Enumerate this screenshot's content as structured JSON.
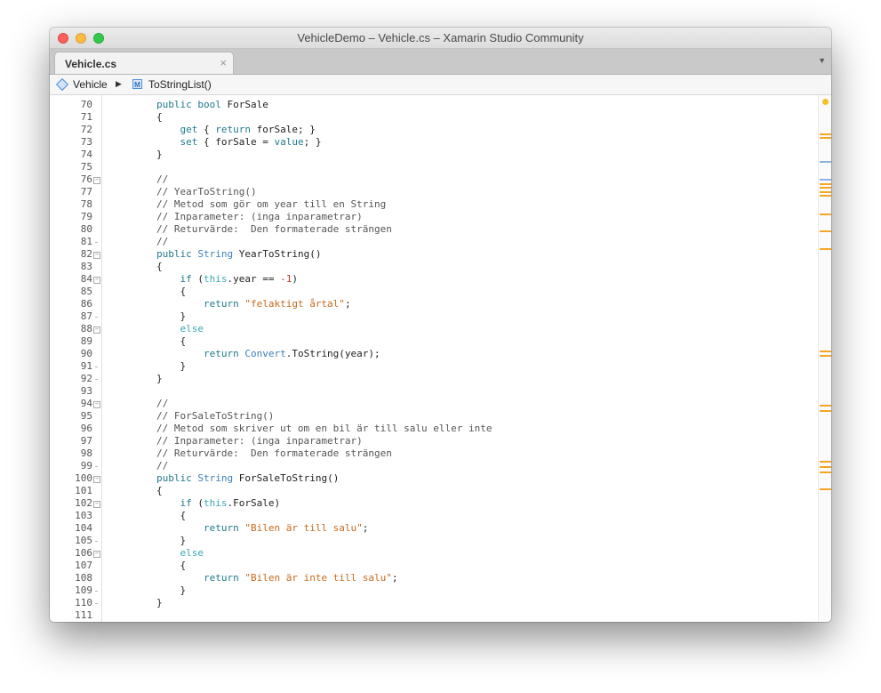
{
  "window": {
    "title": "VehicleDemo – Vehicle.cs – Xamarin Studio Community"
  },
  "tabs": [
    {
      "label": "Vehicle.cs",
      "close": "×"
    }
  ],
  "tab_menu_icon": "▼",
  "breadcrumb": {
    "class_icon": "class-icon",
    "class_name": "Vehicle",
    "separator": "▶",
    "method_icon_letter": "M",
    "method_name": "ToStringList()"
  },
  "colors": {
    "keyword": "#1f7a8c",
    "type": "#3e7fb8",
    "string": "#c66b1e",
    "comment": "#555555",
    "overview_orange": "#f5a623",
    "overview_blue": "#8fb3e0"
  },
  "code_lines": [
    {
      "n": "70",
      "fold": "",
      "tokens": [
        [
          "",
          "        "
        ],
        [
          "kw",
          "public"
        ],
        [
          "",
          " "
        ],
        [
          "kw",
          "bool"
        ],
        [
          "",
          " ForSale"
        ]
      ]
    },
    {
      "n": "71",
      "fold": "",
      "tokens": [
        [
          "",
          "        {"
        ]
      ]
    },
    {
      "n": "72",
      "fold": "",
      "tokens": [
        [
          "",
          "            "
        ],
        [
          "kw",
          "get"
        ],
        [
          "",
          " { "
        ],
        [
          "kw",
          "return"
        ],
        [
          "",
          " forSale; }"
        ]
      ]
    },
    {
      "n": "73",
      "fold": "",
      "tokens": [
        [
          "",
          "            "
        ],
        [
          "kw",
          "set"
        ],
        [
          "",
          " { forSale = "
        ],
        [
          "kw",
          "value"
        ],
        [
          "",
          "; }"
        ]
      ]
    },
    {
      "n": "74",
      "fold": "",
      "tokens": [
        [
          "",
          "        }"
        ]
      ]
    },
    {
      "n": "75",
      "fold": "",
      "tokens": [
        [
          "",
          ""
        ]
      ]
    },
    {
      "n": "76",
      "fold": "minus",
      "tokens": [
        [
          "cm",
          "        //"
        ]
      ]
    },
    {
      "n": "77",
      "fold": "",
      "tokens": [
        [
          "cm",
          "        // YearToString()"
        ]
      ]
    },
    {
      "n": "78",
      "fold": "",
      "tokens": [
        [
          "cm",
          "        // Metod som gör om year till en String"
        ]
      ]
    },
    {
      "n": "79",
      "fold": "",
      "tokens": [
        [
          "cm",
          "        // Inparameter: (inga inparametrar)"
        ]
      ]
    },
    {
      "n": "80",
      "fold": "",
      "tokens": [
        [
          "cm",
          "        // Returvärde:  Den formaterade strängen"
        ]
      ]
    },
    {
      "n": "81",
      "fold": "tick",
      "tokens": [
        [
          "cm",
          "        //"
        ]
      ]
    },
    {
      "n": "82",
      "fold": "minus",
      "tokens": [
        [
          "",
          "        "
        ],
        [
          "kw",
          "public"
        ],
        [
          "",
          " "
        ],
        [
          "ty",
          "String"
        ],
        [
          "",
          " YearToString()"
        ]
      ]
    },
    {
      "n": "83",
      "fold": "",
      "tokens": [
        [
          "",
          "        {"
        ]
      ]
    },
    {
      "n": "84",
      "fold": "minus",
      "tokens": [
        [
          "",
          "            "
        ],
        [
          "kw",
          "if"
        ],
        [
          "",
          " ("
        ],
        [
          "kw2",
          "this"
        ],
        [
          "",
          ".year == "
        ],
        [
          "nm",
          "-1"
        ],
        [
          "",
          ")"
        ]
      ]
    },
    {
      "n": "85",
      "fold": "",
      "tokens": [
        [
          "",
          "            {"
        ]
      ]
    },
    {
      "n": "86",
      "fold": "",
      "tokens": [
        [
          "",
          "                "
        ],
        [
          "kw",
          "return"
        ],
        [
          "",
          " "
        ],
        [
          "st",
          "\"felaktigt årtal\""
        ],
        [
          "",
          ";"
        ]
      ]
    },
    {
      "n": "87",
      "fold": "tick",
      "tokens": [
        [
          "",
          "            }"
        ]
      ]
    },
    {
      "n": "88",
      "fold": "minus",
      "tokens": [
        [
          "",
          "            "
        ],
        [
          "kw2",
          "else"
        ]
      ]
    },
    {
      "n": "89",
      "fold": "",
      "tokens": [
        [
          "",
          "            {"
        ]
      ]
    },
    {
      "n": "90",
      "fold": "",
      "tokens": [
        [
          "",
          "                "
        ],
        [
          "kw",
          "return"
        ],
        [
          "",
          " "
        ],
        [
          "ty",
          "Convert"
        ],
        [
          "",
          ".ToString(year);"
        ]
      ]
    },
    {
      "n": "91",
      "fold": "tick",
      "tokens": [
        [
          "",
          "            }"
        ]
      ]
    },
    {
      "n": "92",
      "fold": "tick",
      "tokens": [
        [
          "",
          "        }"
        ]
      ]
    },
    {
      "n": "93",
      "fold": "",
      "tokens": [
        [
          "",
          ""
        ]
      ]
    },
    {
      "n": "94",
      "fold": "minus",
      "tokens": [
        [
          "cm",
          "        //"
        ]
      ]
    },
    {
      "n": "95",
      "fold": "",
      "tokens": [
        [
          "cm",
          "        // ForSaleToString()"
        ]
      ]
    },
    {
      "n": "96",
      "fold": "",
      "tokens": [
        [
          "cm",
          "        // Metod som skriver ut om en bil är till salu eller inte"
        ]
      ]
    },
    {
      "n": "97",
      "fold": "",
      "tokens": [
        [
          "cm",
          "        // Inparameter: (inga inparametrar)"
        ]
      ]
    },
    {
      "n": "98",
      "fold": "",
      "tokens": [
        [
          "cm",
          "        // Returvärde:  Den formaterade strängen"
        ]
      ]
    },
    {
      "n": "99",
      "fold": "tick",
      "tokens": [
        [
          "cm",
          "        //"
        ]
      ]
    },
    {
      "n": "100",
      "fold": "minus",
      "tokens": [
        [
          "",
          "        "
        ],
        [
          "kw",
          "public"
        ],
        [
          "",
          " "
        ],
        [
          "ty",
          "String"
        ],
        [
          "",
          " ForSaleToString()"
        ]
      ]
    },
    {
      "n": "101",
      "fold": "",
      "tokens": [
        [
          "",
          "        {"
        ]
      ]
    },
    {
      "n": "102",
      "fold": "minus",
      "tokens": [
        [
          "",
          "            "
        ],
        [
          "kw",
          "if"
        ],
        [
          "",
          " ("
        ],
        [
          "kw2",
          "this"
        ],
        [
          "",
          ".ForSale)"
        ]
      ]
    },
    {
      "n": "103",
      "fold": "",
      "tokens": [
        [
          "",
          "            {"
        ]
      ]
    },
    {
      "n": "104",
      "fold": "",
      "tokens": [
        [
          "",
          "                "
        ],
        [
          "kw",
          "return"
        ],
        [
          "",
          " "
        ],
        [
          "st",
          "\"Bilen är till salu\""
        ],
        [
          "",
          ";"
        ]
      ]
    },
    {
      "n": "105",
      "fold": "tick",
      "tokens": [
        [
          "",
          "            }"
        ]
      ]
    },
    {
      "n": "106",
      "fold": "minus",
      "tokens": [
        [
          "",
          "            "
        ],
        [
          "kw2",
          "else"
        ]
      ]
    },
    {
      "n": "107",
      "fold": "",
      "tokens": [
        [
          "",
          "            {"
        ]
      ]
    },
    {
      "n": "108",
      "fold": "",
      "tokens": [
        [
          "",
          "                "
        ],
        [
          "kw",
          "return"
        ],
        [
          "",
          " "
        ],
        [
          "st",
          "\"Bilen är inte till salu\""
        ],
        [
          "",
          ";"
        ]
      ]
    },
    {
      "n": "109",
      "fold": "tick",
      "tokens": [
        [
          "",
          "            }"
        ]
      ]
    },
    {
      "n": "110",
      "fold": "tick",
      "tokens": [
        [
          "",
          "        }"
        ]
      ]
    },
    {
      "n": "111",
      "fold": "",
      "tokens": [
        [
          "",
          ""
        ]
      ]
    }
  ],
  "overview_marks": [
    {
      "line": 2.8,
      "color": "orange"
    },
    {
      "line": 3.1,
      "color": "orange"
    },
    {
      "line": 5.0,
      "color": "blue"
    },
    {
      "line": 6.4,
      "color": "blue"
    },
    {
      "line": 6.8,
      "color": "orange"
    },
    {
      "line": 7.1,
      "color": "orange"
    },
    {
      "line": 7.4,
      "color": "orange"
    },
    {
      "line": 7.7,
      "color": "orange"
    },
    {
      "line": 9.2,
      "color": "orange"
    },
    {
      "line": 10.6,
      "color": "orange"
    },
    {
      "line": 12.0,
      "color": "orange"
    },
    {
      "line": 20.2,
      "color": "orange"
    },
    {
      "line": 20.6,
      "color": "orange"
    },
    {
      "line": 24.6,
      "color": "orange"
    },
    {
      "line": 25.0,
      "color": "orange"
    },
    {
      "line": 29.1,
      "color": "orange"
    },
    {
      "line": 29.5,
      "color": "orange"
    },
    {
      "line": 29.9,
      "color": "orange"
    },
    {
      "line": 31.3,
      "color": "orange"
    }
  ]
}
